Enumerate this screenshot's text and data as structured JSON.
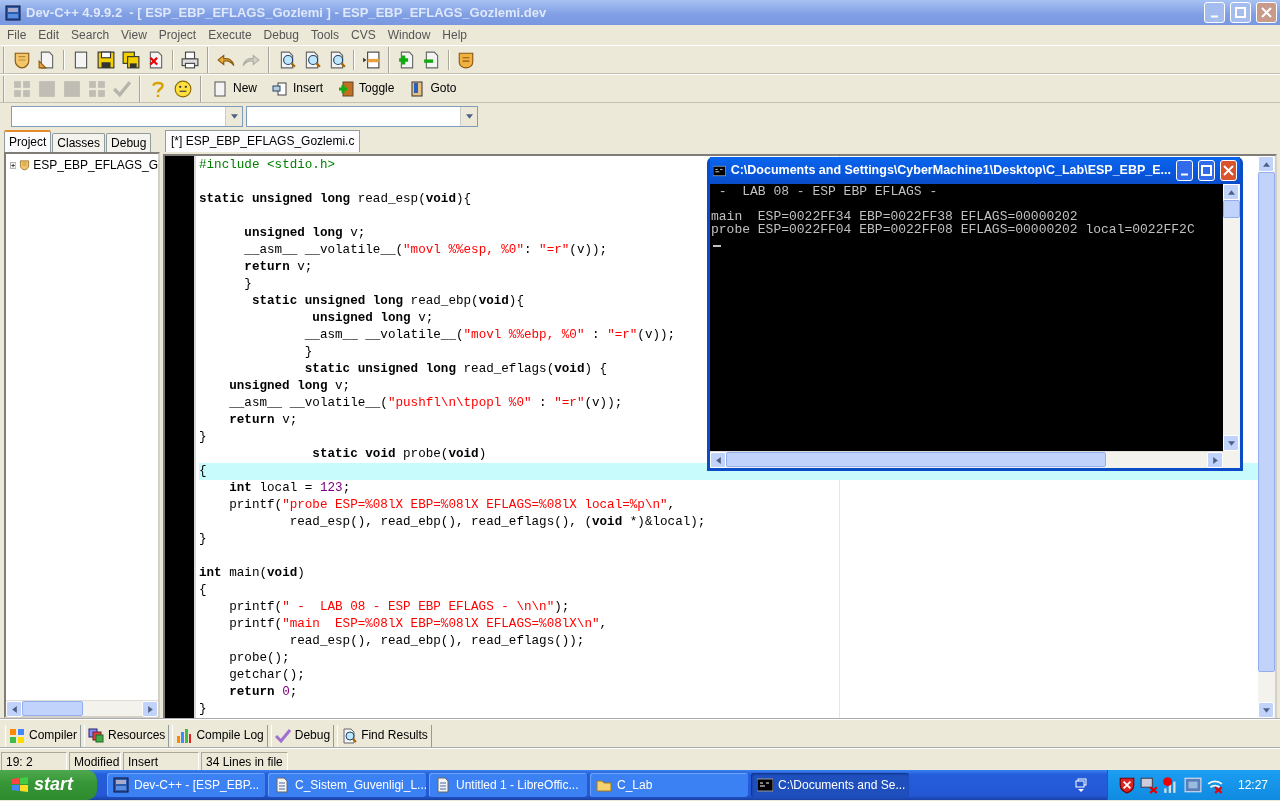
{
  "window": {
    "title": "Dev-C++ 4.9.9.2  - [ ESP_EBP_EFLAGS_Gozlemi ] - ESP_EBP_EFLAGS_Gozlemi.dev",
    "active": false
  },
  "menu": [
    "File",
    "Edit",
    "Search",
    "View",
    "Project",
    "Execute",
    "Debug",
    "Tools",
    "CVS",
    "Window",
    "Help"
  ],
  "toolbar_1": [
    {
      "kind": "open",
      "disabled": false
    },
    {
      "kind": "open-doc",
      "disabled": false
    },
    {
      "kind": "separator"
    },
    {
      "kind": "page",
      "disabled": false
    },
    {
      "kind": "save",
      "disabled": false
    },
    {
      "kind": "save-all",
      "disabled": false
    },
    {
      "kind": "close-doc",
      "disabled": false
    },
    {
      "kind": "separator"
    },
    {
      "kind": "print",
      "disabled": false
    },
    {
      "kind": "band"
    },
    {
      "kind": "undo",
      "disabled": false
    },
    {
      "kind": "redo",
      "disabled": true
    },
    {
      "kind": "band"
    },
    {
      "kind": "find",
      "disabled": false
    },
    {
      "kind": "find",
      "disabled": false
    },
    {
      "kind": "find",
      "disabled": false
    },
    {
      "kind": "separator"
    },
    {
      "kind": "goto-line",
      "disabled": false
    },
    {
      "kind": "band"
    },
    {
      "kind": "add",
      "disabled": false
    },
    {
      "kind": "remove",
      "disabled": false
    },
    {
      "kind": "separator"
    },
    {
      "kind": "bookmark",
      "disabled": false
    }
  ],
  "toolbar_2": [
    {
      "kind": "grid",
      "disabled": true
    },
    {
      "kind": "square",
      "disabled": true
    },
    {
      "kind": "square",
      "disabled": true
    },
    {
      "kind": "grid",
      "disabled": true
    },
    {
      "kind": "check",
      "disabled": true
    },
    {
      "kind": "band"
    },
    {
      "kind": "help",
      "disabled": false
    },
    {
      "kind": "smiley",
      "disabled": false
    },
    {
      "kind": "band"
    },
    {
      "kind": "page",
      "label": "New",
      "disabled": false
    },
    {
      "kind": "insert",
      "label": "Insert",
      "disabled": false
    },
    {
      "kind": "toggle",
      "label": "Toggle",
      "disabled": false
    },
    {
      "kind": "goto",
      "label": "Goto",
      "disabled": false
    }
  ],
  "left_panel": {
    "tabs": [
      {
        "label": "Project",
        "selected": true
      },
      {
        "label": "Classes",
        "selected": false
      },
      {
        "label": "Debug",
        "selected": false
      }
    ],
    "tree": [
      {
        "label": "ESP_EBP_EFLAGS_G",
        "expanded": false
      }
    ]
  },
  "editor": {
    "tabs": [
      {
        "label": "[*] ESP_EBP_EFLAGS_Gozlemi.c",
        "selected": true
      }
    ],
    "lines": [
      {
        "current": false,
        "tokens": [
          {
            "kind": "pre",
            "text": "#include <stdio.h>"
          }
        ]
      },
      {
        "current": false
      },
      {
        "current": false,
        "tokens": [
          {
            "kind": "kw",
            "text": "static unsigned long"
          },
          {
            "kind": "text",
            "text": " read_esp("
          },
          {
            "kind": "kw",
            "text": "void"
          },
          {
            "kind": "text",
            "text": "){"
          }
        ]
      },
      {
        "current": false
      },
      {
        "current": false,
        "tokens": [
          {
            "kind": "kw",
            "text": "      unsigned long"
          },
          {
            "kind": "text",
            "text": " v;"
          }
        ]
      },
      {
        "current": false,
        "tokens": [
          {
            "kind": "text",
            "text": "      __asm__ __volatile__("
          },
          {
            "kind": "str",
            "text": "\"movl %%esp, %0\""
          },
          {
            "kind": "text",
            "text": ": "
          },
          {
            "kind": "str",
            "text": "\"=r\""
          },
          {
            "kind": "text",
            "text": "(v));"
          }
        ]
      },
      {
        "current": false,
        "tokens": [
          {
            "kind": "kw",
            "text": "      return"
          },
          {
            "kind": "text",
            "text": " v;"
          }
        ]
      },
      {
        "current": false,
        "tokens": [
          {
            "kind": "text",
            "text": "      }"
          }
        ]
      },
      {
        "current": false,
        "tokens": [
          {
            "kind": "kw",
            "text": "       static unsigned long"
          },
          {
            "kind": "text",
            "text": " read_ebp("
          },
          {
            "kind": "kw",
            "text": "void"
          },
          {
            "kind": "text",
            "text": "){"
          }
        ]
      },
      {
        "current": false,
        "tokens": [
          {
            "kind": "kw",
            "text": "               unsigned long"
          },
          {
            "kind": "text",
            "text": " v;"
          }
        ]
      },
      {
        "current": false,
        "tokens": [
          {
            "kind": "text",
            "text": "              __asm__ __volatile__("
          },
          {
            "kind": "str",
            "text": "\"movl %%ebp, %0\""
          },
          {
            "kind": "text",
            "text": " : "
          },
          {
            "kind": "str",
            "text": "\"=r\""
          },
          {
            "kind": "text",
            "text": "(v));"
          }
        ]
      },
      {
        "current": false,
        "tokens": [
          {
            "kind": "text",
            "text": "              }"
          }
        ]
      },
      {
        "current": false,
        "tokens": [
          {
            "kind": "kw",
            "text": "              static unsigned long"
          },
          {
            "kind": "text",
            "text": " read_eflags("
          },
          {
            "kind": "kw",
            "text": "void"
          },
          {
            "kind": "text",
            "text": ") {"
          }
        ]
      },
      {
        "current": false,
        "tokens": [
          {
            "kind": "kw",
            "text": "    unsigned long"
          },
          {
            "kind": "text",
            "text": " v;"
          }
        ]
      },
      {
        "current": false,
        "tokens": [
          {
            "kind": "text",
            "text": "    __asm__ __volatile__("
          },
          {
            "kind": "str",
            "text": "\"pushfl\\n\\tpopl %0\""
          },
          {
            "kind": "text",
            "text": " : "
          },
          {
            "kind": "str",
            "text": "\"=r\""
          },
          {
            "kind": "text",
            "text": "(v));"
          }
        ]
      },
      {
        "current": false,
        "tokens": [
          {
            "kind": "kw",
            "text": "    return"
          },
          {
            "kind": "text",
            "text": " v;"
          }
        ]
      },
      {
        "current": false,
        "tokens": [
          {
            "kind": "text",
            "text": "}"
          }
        ]
      },
      {
        "current": false,
        "tokens": [
          {
            "kind": "kw",
            "text": "               static void"
          },
          {
            "kind": "text",
            "text": " probe("
          },
          {
            "kind": "kw",
            "text": "void"
          },
          {
            "kind": "text",
            "text": ")"
          }
        ]
      },
      {
        "current": true,
        "tokens": [
          {
            "kind": "text",
            "text": "{"
          }
        ]
      },
      {
        "current": false,
        "tokens": [
          {
            "kind": "kw",
            "text": "    int"
          },
          {
            "kind": "text",
            "text": " local = "
          },
          {
            "kind": "num",
            "text": "123"
          },
          {
            "kind": "text",
            "text": ";"
          }
        ]
      },
      {
        "current": false,
        "tokens": [
          {
            "kind": "text",
            "text": "    printf("
          },
          {
            "kind": "str",
            "text": "\"probe ESP=%08lX EBP=%08lX EFLAGS=%08lX local=%p\\n\""
          },
          {
            "kind": "text",
            "text": ","
          }
        ]
      },
      {
        "current": false,
        "tokens": [
          {
            "kind": "text",
            "text": "            read_esp(), read_ebp(), read_eflags(), ("
          },
          {
            "kind": "kw",
            "text": "void"
          },
          {
            "kind": "text",
            "text": " *)&local);"
          }
        ]
      },
      {
        "current": false,
        "tokens": [
          {
            "kind": "text",
            "text": "}"
          }
        ]
      },
      {
        "current": false
      },
      {
        "current": false,
        "tokens": [
          {
            "kind": "kw",
            "text": "int"
          },
          {
            "kind": "text",
            "text": " main("
          },
          {
            "kind": "kw",
            "text": "void"
          },
          {
            "kind": "text",
            "text": ")"
          }
        ]
      },
      {
        "current": false,
        "tokens": [
          {
            "kind": "text",
            "text": "{"
          }
        ]
      },
      {
        "current": false,
        "tokens": [
          {
            "kind": "text",
            "text": "    printf("
          },
          {
            "kind": "str",
            "text": "\" -  LAB 08 - ESP EBP EFLAGS - \\n\\n\""
          },
          {
            "kind": "text",
            "text": ");"
          }
        ]
      },
      {
        "current": false,
        "tokens": [
          {
            "kind": "text",
            "text": "    printf("
          },
          {
            "kind": "str",
            "text": "\"main  ESP=%08lX EBP=%08lX EFLAGS=%08lX\\n\""
          },
          {
            "kind": "text",
            "text": ","
          }
        ]
      },
      {
        "current": false,
        "tokens": [
          {
            "kind": "text",
            "text": "            read_esp(), read_ebp(), read_eflags());"
          }
        ]
      },
      {
        "current": false,
        "tokens": [
          {
            "kind": "text",
            "text": "    probe();"
          }
        ]
      },
      {
        "current": false,
        "tokens": [
          {
            "kind": "text",
            "text": "    getchar();"
          }
        ]
      },
      {
        "current": false,
        "tokens": [
          {
            "kind": "kw",
            "text": "    return "
          },
          {
            "kind": "num",
            "text": "0"
          },
          {
            "kind": "text",
            "text": ";"
          }
        ]
      },
      {
        "current": false,
        "tokens": [
          {
            "kind": "text",
            "text": "}"
          }
        ]
      }
    ]
  },
  "console": {
    "title": "C:\\Documents and Settings\\CyberMachine1\\Desktop\\C_Lab\\ESP_EBP_E...",
    "active": true,
    "cursor": true,
    "lines": [
      {
        "text": " -  LAB 08 - ESP EBP EFLAGS -"
      },
      {
        "blank": true
      },
      {
        "text": "main  ESP=0022FF34 EBP=0022FF38 EFLAGS=00000202"
      },
      {
        "text": "probe ESP=0022FF04 EBP=0022FF08 EFLAGS=00000202 local=0022FF2C"
      }
    ]
  },
  "bottom_tabs": [
    {
      "kind": "compiler",
      "label": "Compiler"
    },
    {
      "kind": "resources",
      "label": "Resources"
    },
    {
      "kind": "log",
      "label": "Compile Log"
    },
    {
      "kind": "debug",
      "label": "Debug"
    },
    {
      "kind": "find",
      "label": "Find Results"
    }
  ],
  "status_bar": [
    "19: 2",
    "Modified",
    "Insert",
    "34 Lines in file"
  ],
  "taskbar": {
    "start": "start",
    "tasks": [
      {
        "kind": "app",
        "label": "Dev-C++ - [ESP_EBP...",
        "selected": false
      },
      {
        "kind": "doc",
        "label": "C_Sistem_Guvenligi_L...",
        "selected": false
      },
      {
        "kind": "doc",
        "label": "Untitled 1 - LibreOffic...",
        "selected": false
      },
      {
        "kind": "folder",
        "label": "C_Lab",
        "selected": false
      },
      {
        "kind": "console",
        "label": "C:\\Documents and Se...",
        "selected": true
      }
    ],
    "tray": [
      {
        "kind": "shield"
      },
      {
        "kind": "network"
      },
      {
        "kind": "signal"
      },
      {
        "kind": "monitor"
      },
      {
        "kind": "wifi"
      }
    ],
    "clock": "12:27"
  }
}
